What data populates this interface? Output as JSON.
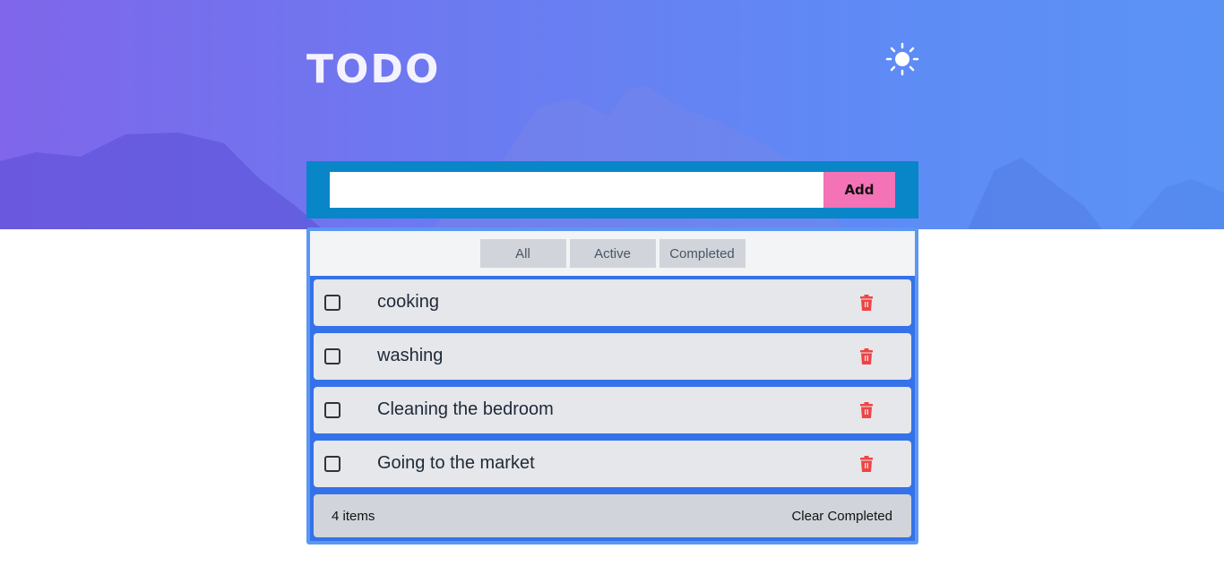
{
  "app": {
    "title": "TODO",
    "theme_icon": "sun-icon"
  },
  "add": {
    "input_value": "",
    "input_placeholder": "",
    "button_label": "Add"
  },
  "filters": [
    {
      "label": "All"
    },
    {
      "label": "Active"
    },
    {
      "label": "Completed"
    }
  ],
  "todos": [
    {
      "label": "cooking",
      "completed": false
    },
    {
      "label": "washing",
      "completed": false
    },
    {
      "label": "Cleaning the bedroom",
      "completed": false
    },
    {
      "label": "Going to the market",
      "completed": false
    }
  ],
  "footer": {
    "count_text": "4 items",
    "clear_label": "Clear Completed"
  },
  "colors": {
    "add_bar": "#0886c8",
    "add_button": "#f472b6",
    "list_background": "#3572e9",
    "delete_icon": "#ef4444"
  }
}
